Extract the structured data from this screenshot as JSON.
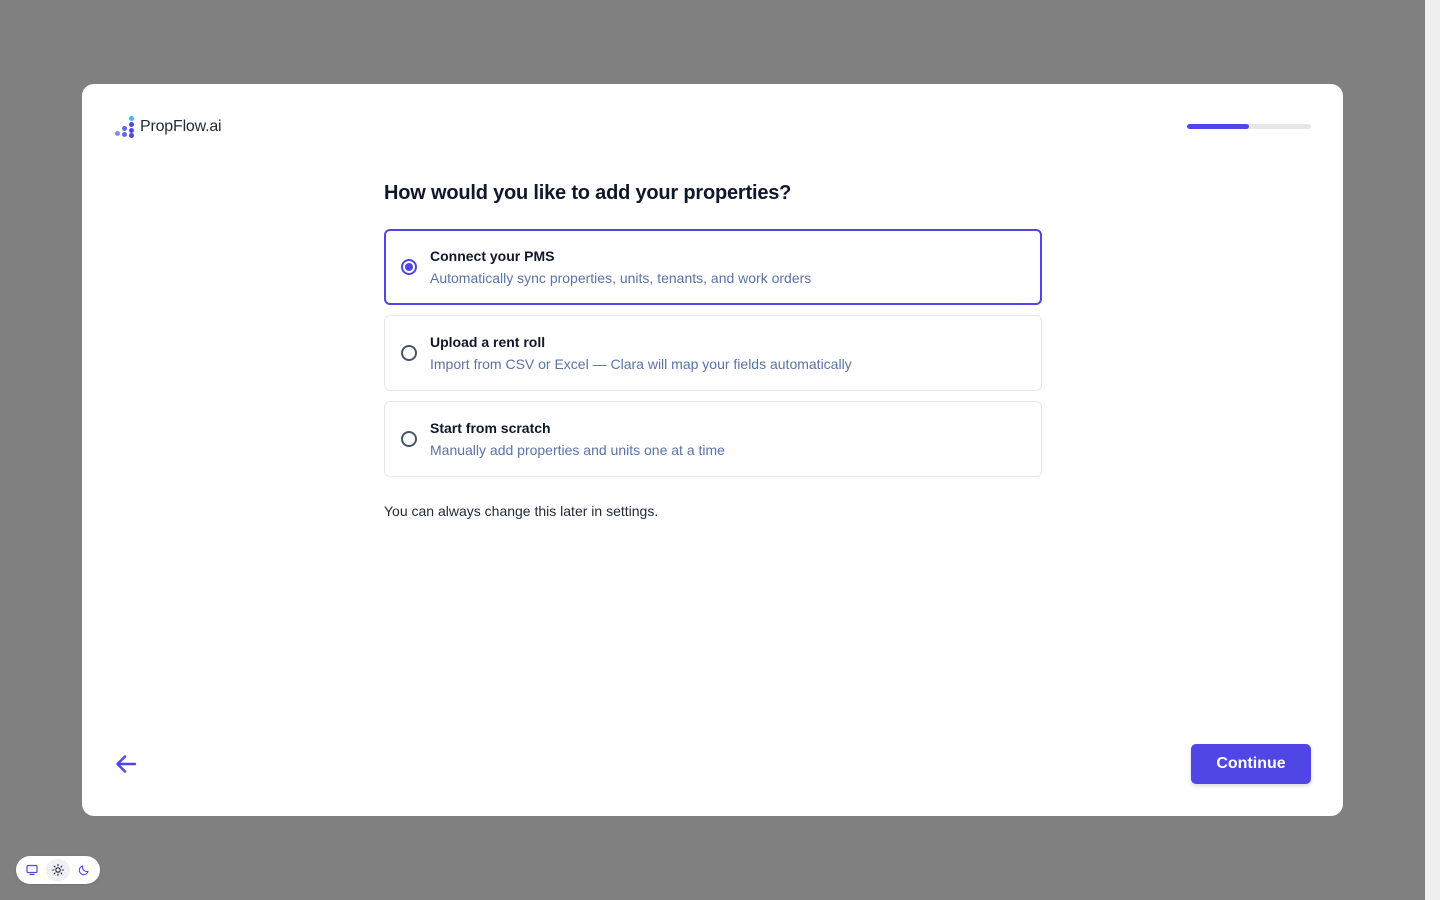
{
  "brand": {
    "name": "PropFlow.ai",
    "accent": "#4f46e5"
  },
  "progress": {
    "fraction": 0.5
  },
  "question": {
    "heading": "How would you like to add your properties?",
    "options": [
      {
        "title": "Connect your PMS",
        "description": "Automatically sync properties, units, tenants, and work orders",
        "selected": true
      },
      {
        "title": "Upload a rent roll",
        "description": "Import from CSV or Excel — Clara will map your fields automatically",
        "selected": false
      },
      {
        "title": "Start from scratch",
        "description": "Manually add properties and units one at a time",
        "selected": false
      }
    ],
    "hint": "You can always change this later in settings."
  },
  "footer": {
    "back_icon": "arrow-left-icon",
    "continue_label": "Continue"
  },
  "theme_switcher": {
    "icons": [
      "monitor-icon",
      "sun-icon",
      "moon-icon"
    ],
    "active": "sun-icon"
  }
}
